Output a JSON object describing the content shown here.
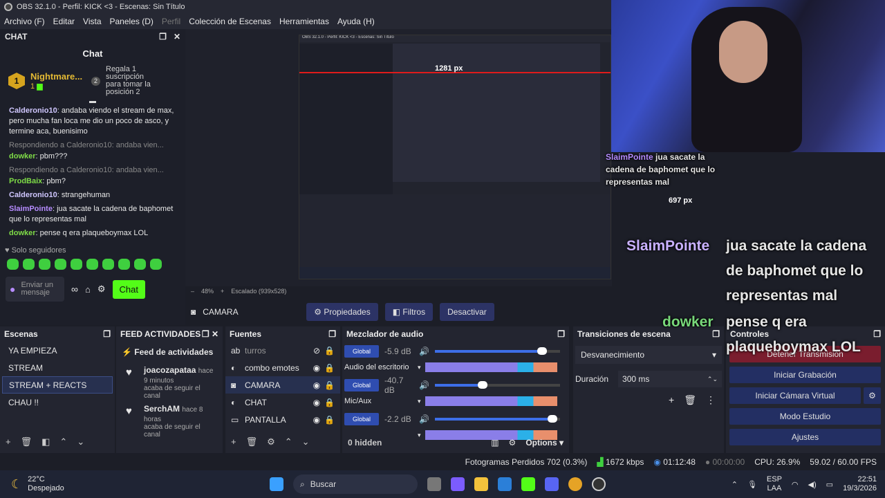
{
  "window": {
    "title": "OBS 32.1.0 - Perfil: KICK <3 - Escenas: Sin Título"
  },
  "menu": [
    "Archivo (F)",
    "Editar",
    "Vista",
    "Paneles (D)",
    "Perfil",
    "Colección de Escenas",
    "Herramientas",
    "Ayuda (H)"
  ],
  "chat": {
    "dock_title": "CHAT",
    "title": "Chat",
    "pinned": {
      "rank": "1",
      "name": "Nightmare...",
      "count": "1",
      "step": "2",
      "text": "Regala 1 suscripción para tomar la posición 2"
    },
    "messages": [
      {
        "reply": "",
        "user": "Calderonio10",
        "text": "andaba viendo el stream de max, pero mucha fan loca me dio un poco de asco, y termine aca, buenisimo",
        "cls": "u3"
      },
      {
        "reply": "Respondiendo a Calderonio10: andaba vien...",
        "user": "dowker",
        "text": "pbm???",
        "cls": "u1"
      },
      {
        "reply": "Respondiendo a Calderonio10: andaba vien...",
        "user": "ProdBaix",
        "text": "pbm?",
        "cls": "u1"
      },
      {
        "reply": "",
        "user": "Calderonio10",
        "text": "strangehuman",
        "cls": "u3"
      },
      {
        "reply": "",
        "user": "SlaimPointe",
        "text": "jua sacate la cadena de baphomet que lo representas mal",
        "cls": "u2"
      },
      {
        "reply": "",
        "user": "dowker",
        "text": "pense q era plaqueboymax LOL",
        "cls": "u1"
      }
    ],
    "followers_only": "Solo seguidores",
    "input_placeholder": "Enviar un mensaje",
    "chat_button": "Chat"
  },
  "preview": {
    "nested_title": "OBS 32.1.0 - Perfil: KICK <3 - Escenas: Sin Título",
    "measure1": "1281 px",
    "measure2": "697 px"
  },
  "overlay": [
    {
      "user": "SlaimPointe",
      "text": "jua sacate la cadena de baphomet que lo representas mal"
    },
    {
      "user": "dowker",
      "text": "pense q era plaqueboymax LOL"
    }
  ],
  "zoom": {
    "minus": "–",
    "value": "48%",
    "plus": "+",
    "scale": "Escalado (939x528)"
  },
  "source_toolbar": {
    "source": "CAMARA",
    "properties": "Propiedades",
    "filters": "Filtros",
    "deactivate": "Desactivar"
  },
  "scenes": {
    "title": "Escenas",
    "items": [
      "YA EMPIEZA",
      "STREAM",
      "STREAM + REACTS",
      "CHAU !!"
    ],
    "selected": 2
  },
  "feed": {
    "title": "FEED ACTIVIDADES",
    "header": "Feed de actividades",
    "items": [
      {
        "name": "joacozapataa",
        "time": "hace 9 minutos",
        "text": "acaba de seguir el canal"
      },
      {
        "name": "SerchAM",
        "time": "hace 8 horas",
        "text": "acaba de seguir el canal"
      }
    ]
  },
  "sources": {
    "title": "Fuentes",
    "items": [
      "turros",
      "combo emotes",
      "CAMARA",
      "CHAT",
      "PANTALLA"
    ]
  },
  "mixer": {
    "title": "Mezclador de audio",
    "tracks": [
      {
        "name": "Global",
        "db": "-5.9 dB",
        "label": "Audio del escritorio",
        "level": 0.82
      },
      {
        "name": "Global",
        "db": "-40.7 dB",
        "label": "Mic/Aux",
        "level": 0.34
      },
      {
        "name": "Global",
        "db": "-2.2 dB",
        "label": "",
        "level": 0.9
      }
    ],
    "scale": [
      "-60",
      "-54",
      "-48",
      "-42",
      "-36",
      "-30",
      "-24",
      "-18",
      "-12",
      "-6",
      "0"
    ],
    "hidden": "0 hidden",
    "options": "Options"
  },
  "transitions": {
    "title": "Transiciones de escena",
    "selected": "Desvanecimiento",
    "duration_label": "Duración",
    "duration": "300 ms"
  },
  "controls": {
    "title": "Controles",
    "buttons": [
      "Detener Transmisión",
      "Iniciar Grabación",
      "Iniciar Cámara Virtual",
      "Modo Estudio",
      "Ajustes"
    ]
  },
  "status": {
    "dropped": "Fotogramas Perdidos 702 (0.3%)",
    "kbps": "1672 kbps",
    "live": "01:12:48",
    "rec": "00:00:00",
    "cpu": "CPU: 26.9%",
    "fps": "59.02 / 60.00 FPS"
  },
  "taskbar": {
    "temp": "22°C",
    "weather": "Despejado",
    "search": "Buscar",
    "lang1": "ESP",
    "lang2": "LAA",
    "time": "22:51",
    "date": "19/3/2026"
  }
}
